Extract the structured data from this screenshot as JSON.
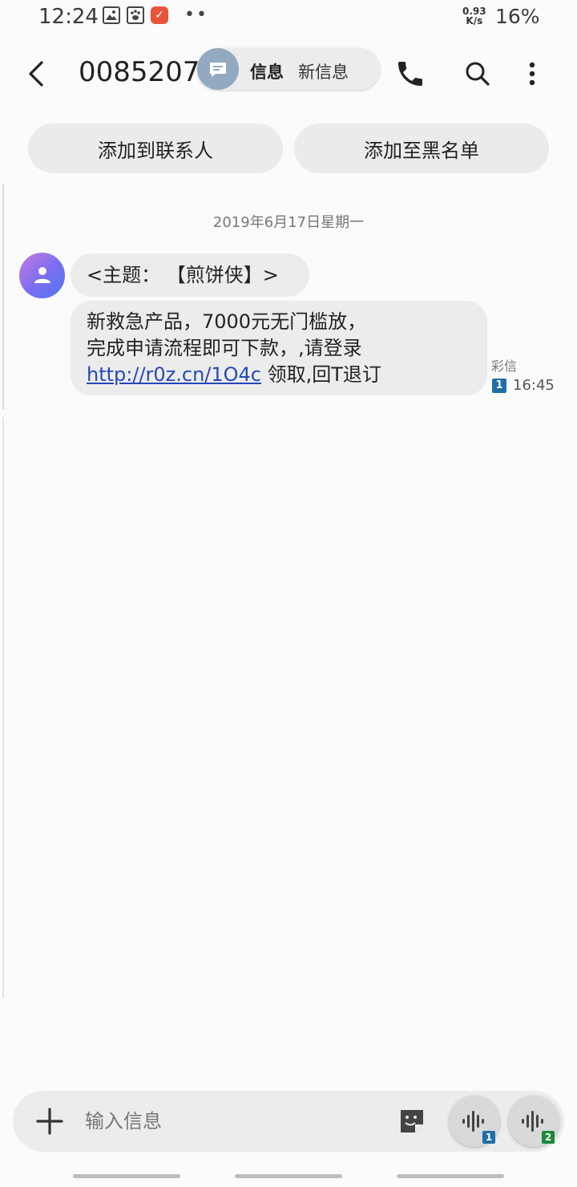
{
  "status_bar": {
    "time": "12:24",
    "net_speed_value": "0.93",
    "net_speed_unit": "K/s",
    "battery": "16%"
  },
  "header": {
    "title": "00852071"
  },
  "notification_chip": {
    "app": "信息",
    "text": "新信息"
  },
  "actions": {
    "add_contact": "添加到联系人",
    "add_blacklist": "添加至黑名单"
  },
  "conversation": {
    "date": "2019年6月17日星期一",
    "message": {
      "subject": "<主题： 【煎饼侠】>",
      "body_line1": "新救急产品，7000元无门槛放，",
      "body_line2": "完成申请流程即可下款，,请登录",
      "link": "http://r0z.cn/1O4c",
      "body_line3_tail": " 领取,回T退订",
      "type": "彩信",
      "sim": "1",
      "time": "16:45"
    }
  },
  "composer": {
    "placeholder": "输入信息",
    "sim1": "1",
    "sim2": "2"
  },
  "colors": {
    "link": "#2748b8",
    "sim1": "#1f6fa8",
    "sim2": "#1b8a3a",
    "chip_avatar": "#93a9c2",
    "badge_app": "#e8543a"
  }
}
